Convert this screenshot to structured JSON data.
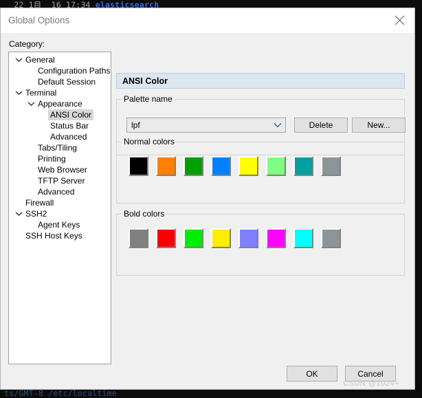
{
  "terminal": {
    "top_line_prefix": "  22 1目  16 17:34 ",
    "top_line_highlight": "elasticsearch",
    "bottom_line": "ts/GMT-8 /etc/localtime"
  },
  "dialog": {
    "title": "Global Options",
    "close_icon": "close-icon",
    "category_label": "Category:"
  },
  "tree": {
    "items": [
      {
        "label": "General",
        "depth": 0,
        "twisty": "expanded",
        "selected": false
      },
      {
        "label": "Configuration Paths",
        "depth": 1,
        "twisty": "none",
        "selected": false
      },
      {
        "label": "Default Session",
        "depth": 1,
        "twisty": "none",
        "selected": false
      },
      {
        "label": "Terminal",
        "depth": 0,
        "twisty": "expanded",
        "selected": false
      },
      {
        "label": "Appearance",
        "depth": 1,
        "twisty": "expanded",
        "selected": false
      },
      {
        "label": "ANSI Color",
        "depth": 2,
        "twisty": "none",
        "selected": true
      },
      {
        "label": "Status Bar",
        "depth": 2,
        "twisty": "none",
        "selected": false
      },
      {
        "label": "Advanced",
        "depth": 2,
        "twisty": "none",
        "selected": false
      },
      {
        "label": "Tabs/Tiling",
        "depth": 1,
        "twisty": "none",
        "selected": false
      },
      {
        "label": "Printing",
        "depth": 1,
        "twisty": "none",
        "selected": false
      },
      {
        "label": "Web Browser",
        "depth": 1,
        "twisty": "none",
        "selected": false
      },
      {
        "label": "TFTP Server",
        "depth": 1,
        "twisty": "none",
        "selected": false
      },
      {
        "label": "Advanced",
        "depth": 1,
        "twisty": "none",
        "selected": false
      },
      {
        "label": "Firewall",
        "depth": 0,
        "twisty": "none",
        "selected": false
      },
      {
        "label": "SSH2",
        "depth": 0,
        "twisty": "expanded",
        "selected": false
      },
      {
        "label": "Agent Keys",
        "depth": 1,
        "twisty": "none",
        "selected": false
      },
      {
        "label": "SSH Host Keys",
        "depth": 0,
        "twisty": "none",
        "selected": false
      }
    ]
  },
  "content": {
    "section_title": "ANSI Color",
    "palette_group_title": "Palette name",
    "palette_value": "lpf",
    "palette_dropdown_icon": "chevron-down-icon",
    "delete_label": "Delete",
    "new_label": "New...",
    "normal_group_title": "Normal colors",
    "bold_group_title": "Bold colors",
    "normal_colors": [
      "#000000",
      "#ff8000",
      "#00a000",
      "#0080ff",
      "#ffff00",
      "#80ff80",
      "#00a0a0",
      "#8c9699"
    ],
    "bold_colors": [
      "#808080",
      "#f90000",
      "#00ee00",
      "#ffee00",
      "#8080ff",
      "#ff00ff",
      "#00ffff",
      "#8c9699"
    ]
  },
  "footer": {
    "ok_label": "OK",
    "cancel_label": "Cancel",
    "watermark": "CSDN @1024+"
  }
}
